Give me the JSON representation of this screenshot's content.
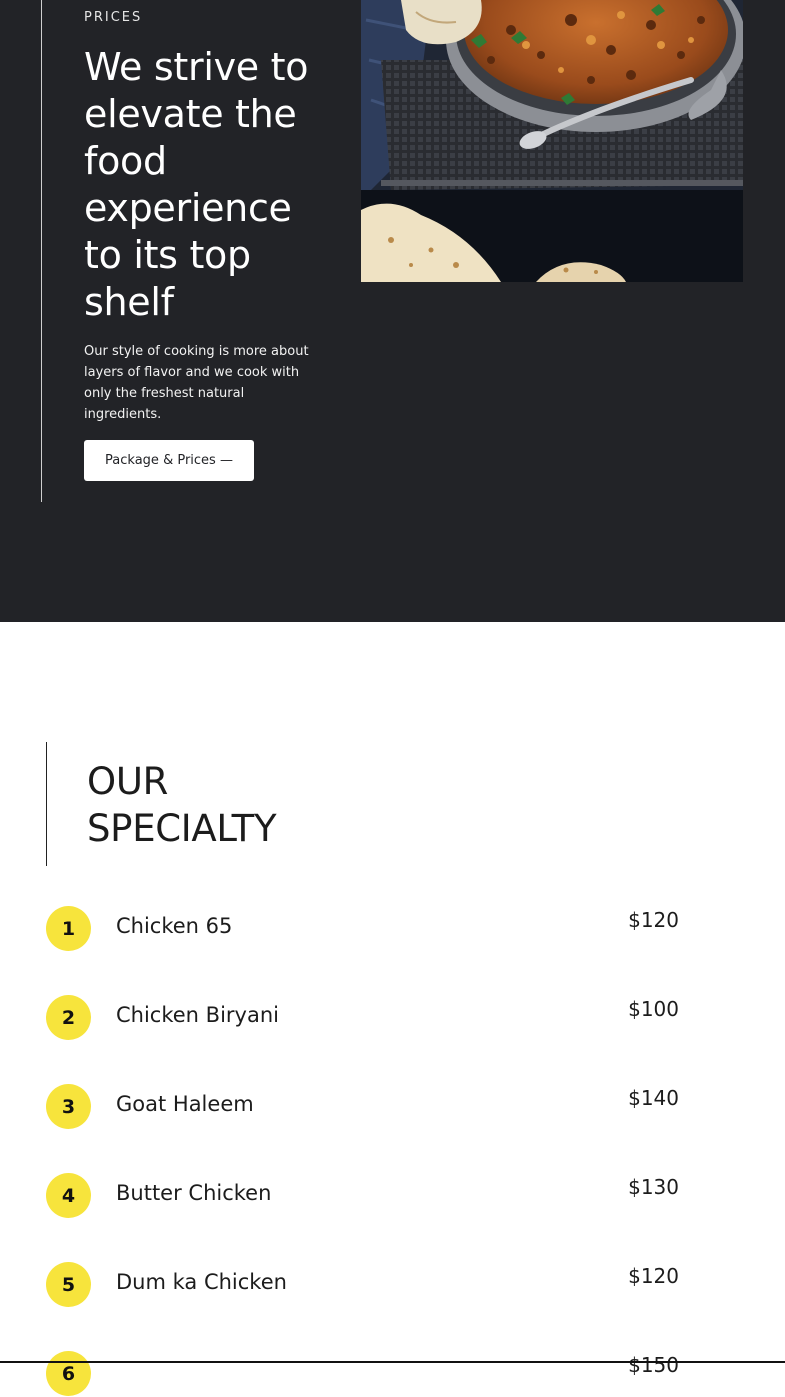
{
  "hero": {
    "eyebrow": "PRICES",
    "title": "We strive to elevate the food experience to its top shelf",
    "description": "Our style of cooking is more about layers of flavor and we cook with only the freshest natural ingredients.",
    "cta_label": "Package & Prices —"
  },
  "specialty": {
    "title_line1": "OUR",
    "title_line2": "SPECIALTY",
    "items": [
      {
        "num": "1",
        "name": "Chicken 65",
        "price": "$120"
      },
      {
        "num": "2",
        "name": "Chicken Biryani",
        "price": "$100"
      },
      {
        "num": "3",
        "name": "Goat Haleem",
        "price": "$140"
      },
      {
        "num": "4",
        "name": "Butter Chicken",
        "price": "$130"
      },
      {
        "num": "5",
        "name": "Dum ka Chicken",
        "price": "$120"
      },
      {
        "num": "6",
        "name": "",
        "price": "$150"
      }
    ]
  },
  "colors": {
    "hero_bg": "#222327",
    "accent_yellow": "#f7e43c"
  }
}
